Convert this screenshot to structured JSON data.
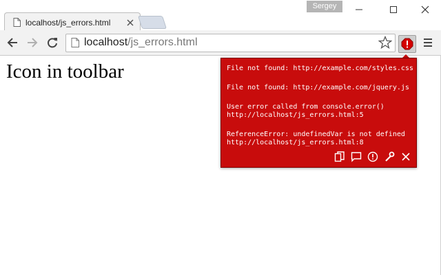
{
  "window": {
    "user": "Sergey",
    "controls": {
      "minimize": "minimize-icon",
      "maximize": "maximize-icon",
      "close": "close-icon"
    }
  },
  "tab": {
    "title": "localhost/js_errors.html",
    "favicon": "page-icon",
    "close": "close-icon"
  },
  "toolbar": {
    "back": "back-arrow-icon",
    "forward": "forward-arrow-icon",
    "reload": "reload-icon",
    "url_host": "localhost",
    "url_path": "/js_errors.html",
    "star": "star-icon",
    "extension_icon": "error-badge-icon",
    "menu": "hamburger-menu-icon"
  },
  "page": {
    "heading": "Icon in toolbar"
  },
  "popup": {
    "messages": [
      {
        "lines": [
          "File not found: http://example.com/styles.css"
        ]
      },
      {
        "lines": [
          "File not found: http://example.com/jquery.js"
        ]
      },
      {
        "lines": [
          "User error called from console.error()",
          "http://localhost/js_errors.html:5"
        ]
      },
      {
        "lines": [
          "ReferenceError: undefinedVar is not defined",
          "http://localhost/js_errors.html:8"
        ]
      }
    ],
    "actions": [
      "copy-icon",
      "comment-icon",
      "alert-icon",
      "wrench-icon",
      "close-icon"
    ]
  },
  "colors": {
    "popup_bg": "#c80c0c",
    "popup_text": "#ffffff",
    "toolbar_bg": "#f2f2f2",
    "user_badge_bg": "#b5b5b5"
  }
}
